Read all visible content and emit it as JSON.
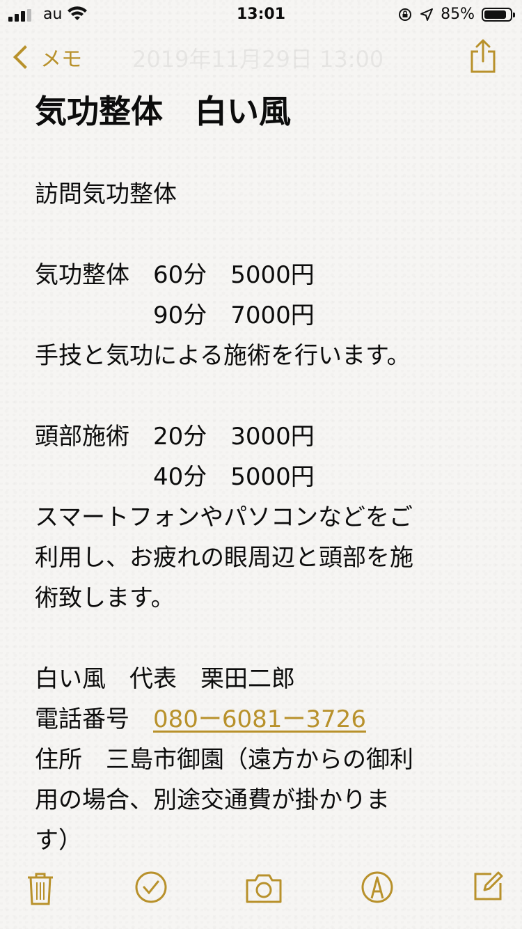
{
  "status_bar": {
    "carrier": "au",
    "time": "13:01",
    "battery_percent": "85%",
    "battery_level": 0.85
  },
  "nav": {
    "back_label": "メモ",
    "ghost_date": "2019年11月29日 13:00"
  },
  "note": {
    "title": "気功整体　白い風",
    "lines": [
      "",
      "訪問気功整体",
      "",
      "気功整体　60分　5000円",
      "　　　　　90分　7000円",
      "手技と気功による施術を行います。",
      "",
      "頭部施術　20分　3000円",
      "　　　　　40分　5000円",
      "スマートフォンやパソコンなどをご",
      "利用し、お疲れの眼周辺と頭部を施",
      "術致します。",
      "",
      "白い風　代表　栗田二郎"
    ],
    "phone_label": "電話番号　",
    "phone_number": "080ー6081ー3726",
    "address_lines": [
      "住所　三島市御園（遠方からの御利",
      "用の場合、別途交通費が掛かりま",
      "す）"
    ]
  },
  "accent_color": "#b8912b",
  "toolbar_icons": [
    "trash-icon",
    "checklist-icon",
    "camera-icon",
    "markup-icon",
    "compose-icon"
  ]
}
